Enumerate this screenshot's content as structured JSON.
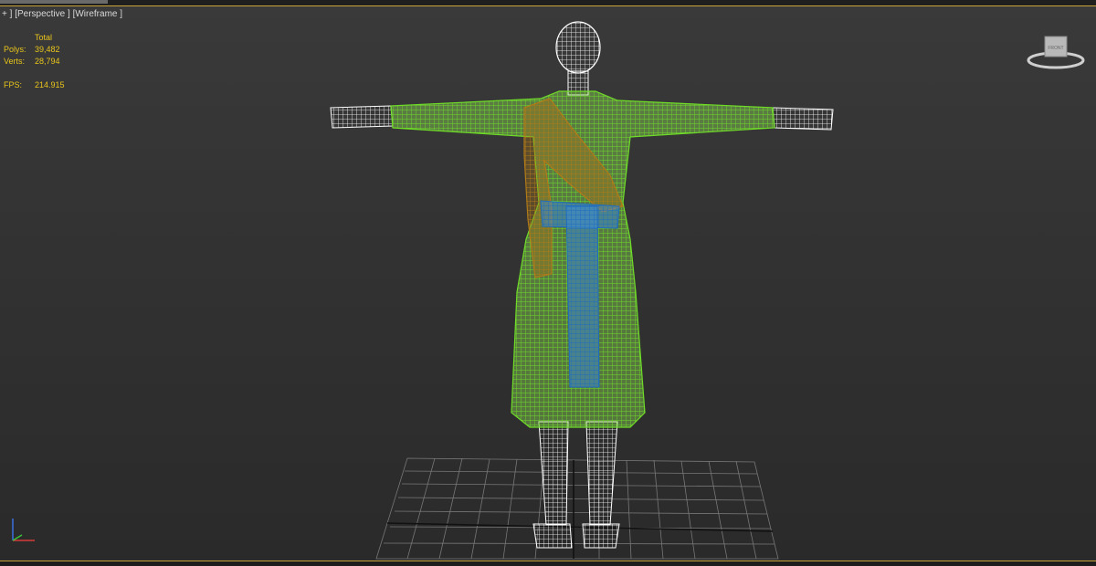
{
  "viewport": {
    "label_plus": "+ ]",
    "label_view": "[Perspective ]",
    "label_shading": "[Wireframe ]"
  },
  "stats": {
    "header": "Total",
    "polys_label": "Polys:",
    "polys_value": "39,482",
    "verts_label": "Verts:",
    "verts_value": "28,794",
    "fps_label": "FPS:",
    "fps_value": "214.915"
  },
  "viewcube": {
    "face_label": "FRONT"
  },
  "colors": {
    "stats_text": "#e8c41a",
    "wire_white": "#ffffff",
    "wire_green": "#7fe23a",
    "wire_blue": "#2c7fd6",
    "wire_orange": "#b07a18",
    "grid": "#8a8a8a",
    "frame_accent": "#c9a23a"
  },
  "icons": [
    "viewcube-icon",
    "axis-tripod-icon"
  ]
}
